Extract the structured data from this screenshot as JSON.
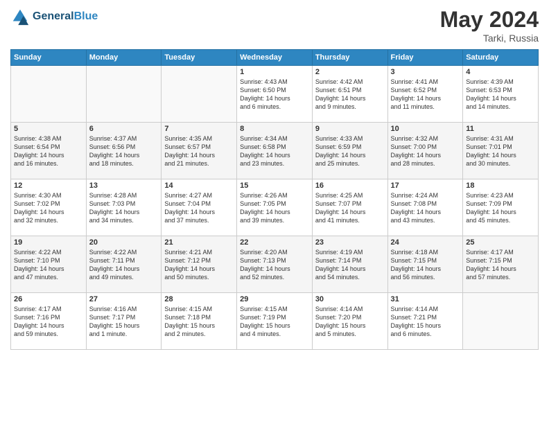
{
  "header": {
    "logo_line1": "General",
    "logo_line2": "Blue",
    "month": "May 2024",
    "location": "Tarki, Russia"
  },
  "days_of_week": [
    "Sunday",
    "Monday",
    "Tuesday",
    "Wednesday",
    "Thursday",
    "Friday",
    "Saturday"
  ],
  "weeks": [
    [
      {
        "day": "",
        "info": ""
      },
      {
        "day": "",
        "info": ""
      },
      {
        "day": "",
        "info": ""
      },
      {
        "day": "1",
        "info": "Sunrise: 4:43 AM\nSunset: 6:50 PM\nDaylight: 14 hours\nand 6 minutes."
      },
      {
        "day": "2",
        "info": "Sunrise: 4:42 AM\nSunset: 6:51 PM\nDaylight: 14 hours\nand 9 minutes."
      },
      {
        "day": "3",
        "info": "Sunrise: 4:41 AM\nSunset: 6:52 PM\nDaylight: 14 hours\nand 11 minutes."
      },
      {
        "day": "4",
        "info": "Sunrise: 4:39 AM\nSunset: 6:53 PM\nDaylight: 14 hours\nand 14 minutes."
      }
    ],
    [
      {
        "day": "5",
        "info": "Sunrise: 4:38 AM\nSunset: 6:54 PM\nDaylight: 14 hours\nand 16 minutes."
      },
      {
        "day": "6",
        "info": "Sunrise: 4:37 AM\nSunset: 6:56 PM\nDaylight: 14 hours\nand 18 minutes."
      },
      {
        "day": "7",
        "info": "Sunrise: 4:35 AM\nSunset: 6:57 PM\nDaylight: 14 hours\nand 21 minutes."
      },
      {
        "day": "8",
        "info": "Sunrise: 4:34 AM\nSunset: 6:58 PM\nDaylight: 14 hours\nand 23 minutes."
      },
      {
        "day": "9",
        "info": "Sunrise: 4:33 AM\nSunset: 6:59 PM\nDaylight: 14 hours\nand 25 minutes."
      },
      {
        "day": "10",
        "info": "Sunrise: 4:32 AM\nSunset: 7:00 PM\nDaylight: 14 hours\nand 28 minutes."
      },
      {
        "day": "11",
        "info": "Sunrise: 4:31 AM\nSunset: 7:01 PM\nDaylight: 14 hours\nand 30 minutes."
      }
    ],
    [
      {
        "day": "12",
        "info": "Sunrise: 4:30 AM\nSunset: 7:02 PM\nDaylight: 14 hours\nand 32 minutes."
      },
      {
        "day": "13",
        "info": "Sunrise: 4:28 AM\nSunset: 7:03 PM\nDaylight: 14 hours\nand 34 minutes."
      },
      {
        "day": "14",
        "info": "Sunrise: 4:27 AM\nSunset: 7:04 PM\nDaylight: 14 hours\nand 37 minutes."
      },
      {
        "day": "15",
        "info": "Sunrise: 4:26 AM\nSunset: 7:05 PM\nDaylight: 14 hours\nand 39 minutes."
      },
      {
        "day": "16",
        "info": "Sunrise: 4:25 AM\nSunset: 7:07 PM\nDaylight: 14 hours\nand 41 minutes."
      },
      {
        "day": "17",
        "info": "Sunrise: 4:24 AM\nSunset: 7:08 PM\nDaylight: 14 hours\nand 43 minutes."
      },
      {
        "day": "18",
        "info": "Sunrise: 4:23 AM\nSunset: 7:09 PM\nDaylight: 14 hours\nand 45 minutes."
      }
    ],
    [
      {
        "day": "19",
        "info": "Sunrise: 4:22 AM\nSunset: 7:10 PM\nDaylight: 14 hours\nand 47 minutes."
      },
      {
        "day": "20",
        "info": "Sunrise: 4:22 AM\nSunset: 7:11 PM\nDaylight: 14 hours\nand 49 minutes."
      },
      {
        "day": "21",
        "info": "Sunrise: 4:21 AM\nSunset: 7:12 PM\nDaylight: 14 hours\nand 50 minutes."
      },
      {
        "day": "22",
        "info": "Sunrise: 4:20 AM\nSunset: 7:13 PM\nDaylight: 14 hours\nand 52 minutes."
      },
      {
        "day": "23",
        "info": "Sunrise: 4:19 AM\nSunset: 7:14 PM\nDaylight: 14 hours\nand 54 minutes."
      },
      {
        "day": "24",
        "info": "Sunrise: 4:18 AM\nSunset: 7:15 PM\nDaylight: 14 hours\nand 56 minutes."
      },
      {
        "day": "25",
        "info": "Sunrise: 4:17 AM\nSunset: 7:15 PM\nDaylight: 14 hours\nand 57 minutes."
      }
    ],
    [
      {
        "day": "26",
        "info": "Sunrise: 4:17 AM\nSunset: 7:16 PM\nDaylight: 14 hours\nand 59 minutes."
      },
      {
        "day": "27",
        "info": "Sunrise: 4:16 AM\nSunset: 7:17 PM\nDaylight: 15 hours\nand 1 minute."
      },
      {
        "day": "28",
        "info": "Sunrise: 4:15 AM\nSunset: 7:18 PM\nDaylight: 15 hours\nand 2 minutes."
      },
      {
        "day": "29",
        "info": "Sunrise: 4:15 AM\nSunset: 7:19 PM\nDaylight: 15 hours\nand 4 minutes."
      },
      {
        "day": "30",
        "info": "Sunrise: 4:14 AM\nSunset: 7:20 PM\nDaylight: 15 hours\nand 5 minutes."
      },
      {
        "day": "31",
        "info": "Sunrise: 4:14 AM\nSunset: 7:21 PM\nDaylight: 15 hours\nand 6 minutes."
      },
      {
        "day": "",
        "info": ""
      }
    ]
  ]
}
